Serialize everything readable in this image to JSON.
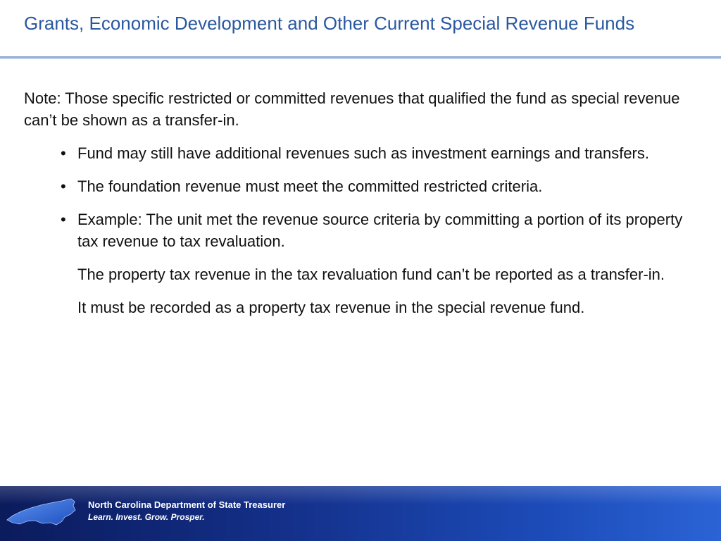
{
  "slide": {
    "title": "Grants, Economic Development and Other Current Special Revenue Funds",
    "note": "Note: Those specific restricted or committed revenues that qualified the fund as special revenue can’t be shown as a transfer-in.",
    "bullets": [
      "Fund may still have additional revenues such as investment earnings and transfers.",
      "The foundation revenue must meet the committed restricted criteria.",
      "Example:  The unit met the revenue source criteria by committing a portion of its property tax revenue to tax revaluation."
    ],
    "paragraphs": [
      "The property tax revenue in the tax revaluation fund can’t be reported as a transfer-in.",
      "It must be recorded as a property tax revenue in the special revenue fund."
    ],
    "bullet_glyph": "•"
  },
  "footer": {
    "organization": "North Carolina Department of State Treasurer",
    "tagline": "Learn.  Invest.  Grow.  Prosper.",
    "logo_icon": "north-carolina-map-icon"
  },
  "colors": {
    "title": "#2a58a0",
    "footer_dark": "#0b1b5c",
    "footer_light": "#2b63d6",
    "map_fill": "#2f6fe0"
  }
}
